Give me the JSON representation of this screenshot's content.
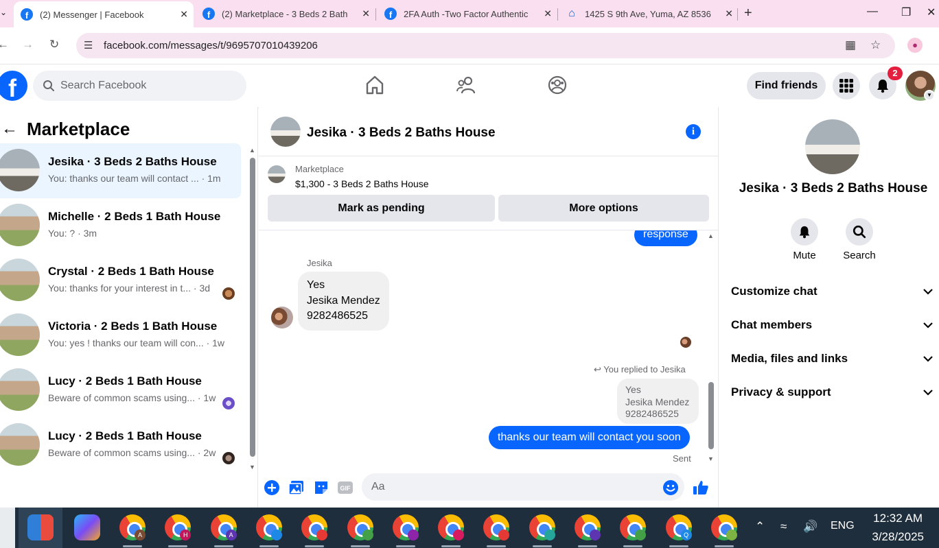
{
  "browser": {
    "tabs": [
      {
        "title": "(2) Messenger | Facebook",
        "active": true,
        "icon": "facebook-icon"
      },
      {
        "title": "(2) Marketplace - 3 Beds 2 Bath",
        "active": false,
        "icon": "facebook-icon"
      },
      {
        "title": "2FA Auth -Two Factor Authentic",
        "active": false,
        "icon": "facebook-icon"
      },
      {
        "title": "1425 S 9th Ave, Yuma, AZ 8536",
        "active": false,
        "icon": "zillow-icon"
      }
    ],
    "url": "facebook.com/messages/t/9695707010439206"
  },
  "fb_header": {
    "search_placeholder": "Search Facebook",
    "find_friends_label": "Find friends",
    "notification_count": "2"
  },
  "left_panel": {
    "title": "Marketplace",
    "conversations": [
      {
        "name": "Jesika · 3 Beds 2 Baths House",
        "preview": "You: thanks our team will contact ... · 1m",
        "selected": true,
        "avatar": "gray"
      },
      {
        "name": "Michelle · 2 Beds 1 Bath House",
        "preview": "You: ? · 3m",
        "selected": false,
        "avatar": "green"
      },
      {
        "name": "Crystal · 2 Beds 1 Bath House",
        "preview": "You: thanks for your interest in t... · 3d",
        "selected": false,
        "avatar": "green"
      },
      {
        "name": "Victoria · 2 Beds 1 Bath House",
        "preview": "You: yes ! thanks our team will con... · 1w",
        "selected": false,
        "avatar": "green"
      },
      {
        "name": "Lucy · 2 Beds 1 Bath House",
        "preview": "Beware of common scams using... · 1w",
        "selected": false,
        "avatar": "green"
      },
      {
        "name": "Lucy · 2 Beds 1 Bath House",
        "preview": "Beware of common scams using... · 2w",
        "selected": false,
        "avatar": "green"
      }
    ]
  },
  "chat": {
    "title": "Jesika · 3 Beds 2 Baths House",
    "listing": {
      "category": "Marketplace",
      "title": "$1,300 - 3 Beds 2 Baths House",
      "mark_pending_label": "Mark as pending",
      "more_options_label": "More options"
    },
    "messages": {
      "partial_outgoing": "response",
      "sender_name": "Jesika",
      "incoming_lines": [
        "Yes",
        "Jesika Mendez",
        "9282486525"
      ],
      "reply_label": "You replied to Jesika",
      "quoted_lines": [
        "Yes",
        "Jesika Mendez",
        "9282486525"
      ],
      "outgoing": "thanks our team will contact you soon",
      "status": "Sent"
    },
    "composer_placeholder": "Aa"
  },
  "right_panel": {
    "title": "Jesika · 3 Beds 2 Baths House",
    "actions": [
      {
        "label": "Mute",
        "icon": "bell-icon"
      },
      {
        "label": "Search",
        "icon": "search-icon"
      }
    ],
    "sections": [
      "Customize chat",
      "Chat members",
      "Media, files and links",
      "Privacy & support"
    ]
  },
  "taskbar": {
    "language": "ENG",
    "time": "12:32 AM",
    "date": "3/28/2025",
    "chrome_profiles": [
      "A",
      "H",
      "A",
      "",
      "",
      "",
      "",
      "",
      "",
      "",
      "",
      "",
      "Q",
      ""
    ]
  },
  "colors": {
    "fb_blue": "#0866ff",
    "tab_bar": "#f9dff0",
    "selected_row": "#ebf5ff",
    "taskbar": "#1f2e3c"
  }
}
